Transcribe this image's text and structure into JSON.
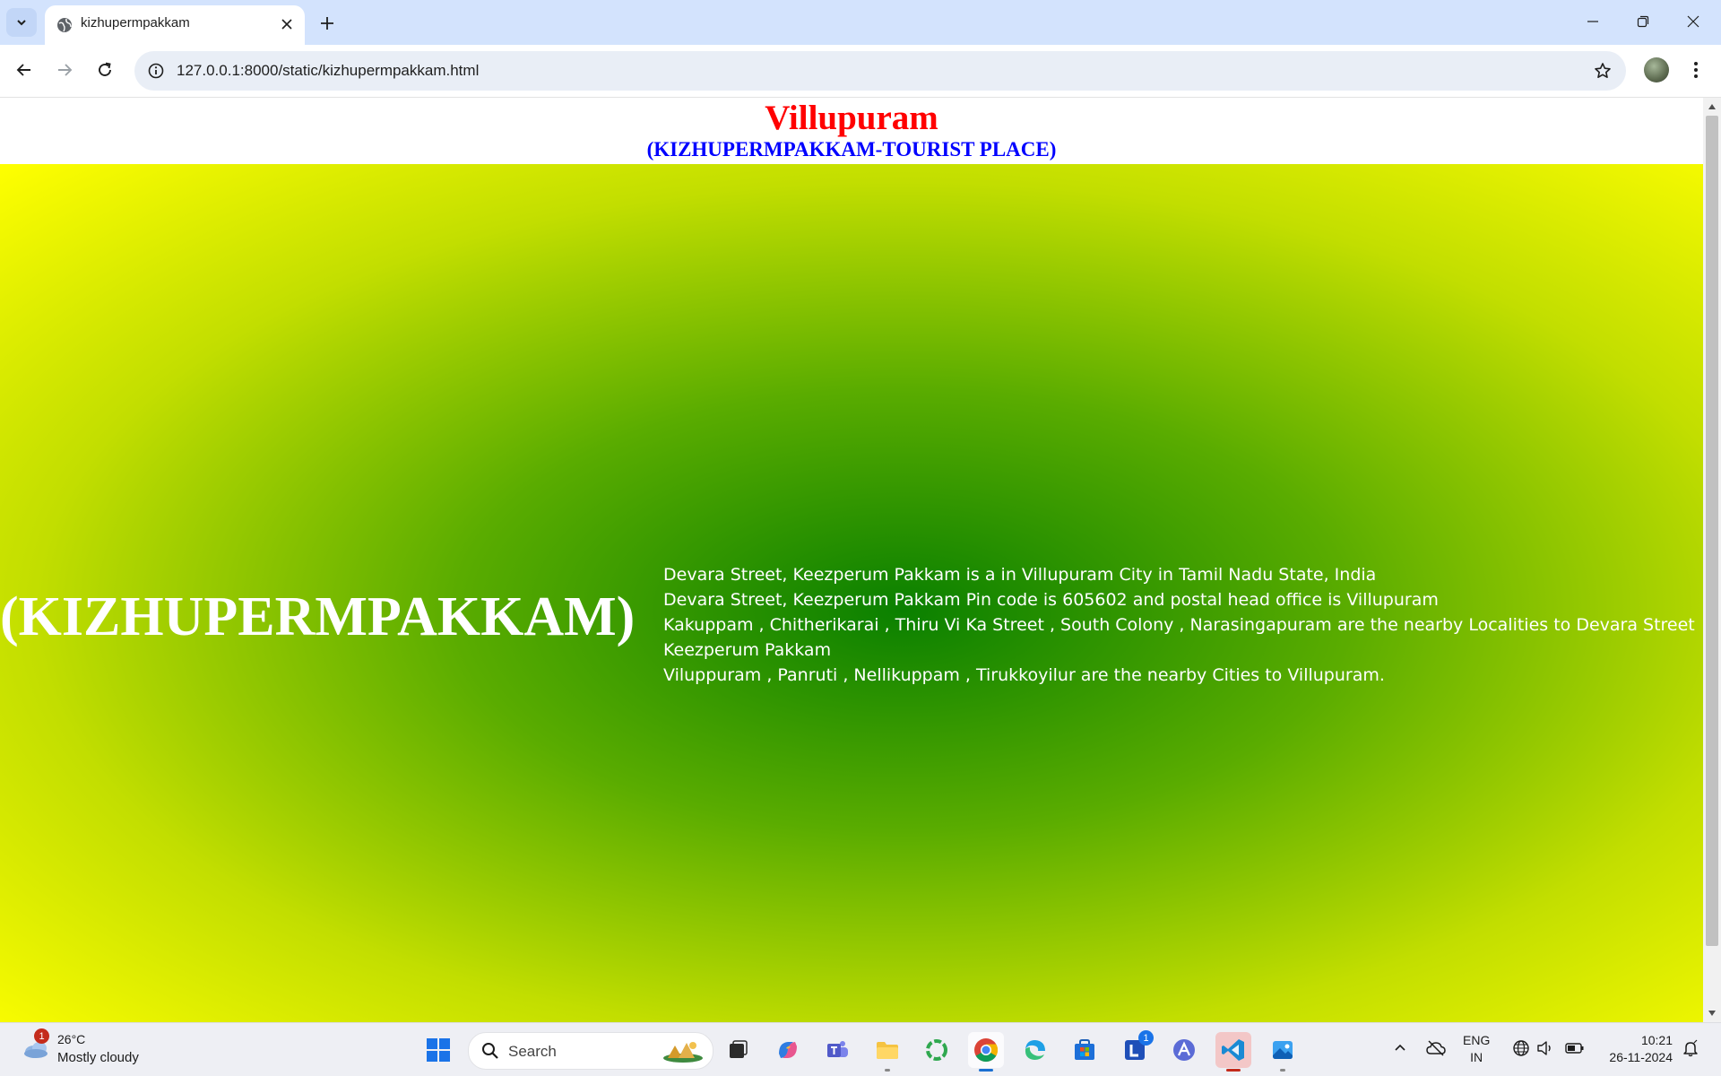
{
  "browser": {
    "tab_title": "kizhupermpakkam",
    "url": "127.0.0.1:8000/static/kizhupermpakkam.html"
  },
  "page": {
    "title": "Villupuram",
    "subtitle": "(KIZHUPERMPAKKAM-TOURIST PLACE)",
    "hero_heading": "(KIZHUPERMPAKKAM)",
    "lines": [
      "Devara Street, Keezperum Pakkam is a in Villupuram City in Tamil Nadu State, India",
      "Devara Street, Keezperum Pakkam Pin code is 605602 and postal head office is Villupuram",
      "Kakuppam , Chitherikarai , Thiru Vi Ka Street , South Colony , Narasingapuram are the nearby Localities to Devara Street",
      "Keezperum Pakkam",
      "Viluppuram , Panruti , Nellikuppam , Tirukkoyilur are the nearby Cities to Villupuram."
    ],
    "colors": {
      "title": "#ff0000",
      "subtitle": "#0000ff",
      "hero_center": "#0a8000",
      "hero_edge": "#ffff00"
    }
  },
  "taskbar": {
    "weather_badge": "1",
    "weather_temp": "26°C",
    "weather_desc": "Mostly cloudy",
    "search_label": "Search",
    "app_badge": "1",
    "lang_line1": "ENG",
    "lang_line2": "IN",
    "time": "10:21",
    "date": "26-11-2024"
  }
}
